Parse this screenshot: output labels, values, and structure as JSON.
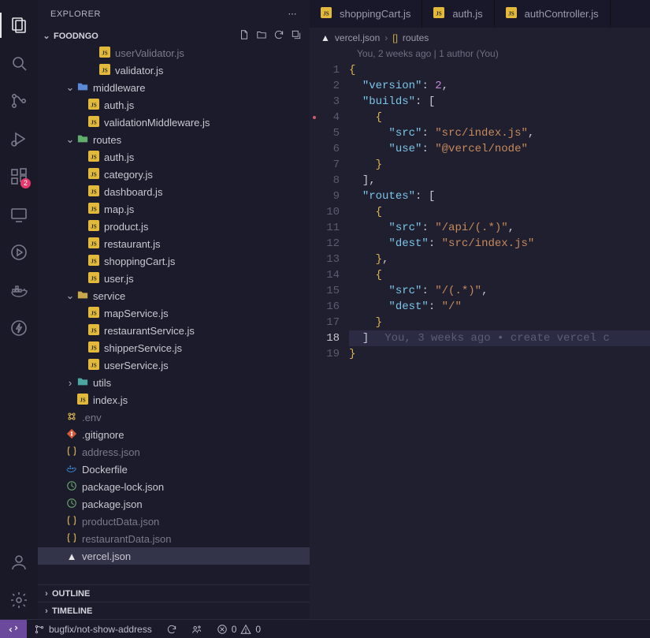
{
  "sidebar": {
    "title": "EXPLORER",
    "project": "FOODNGO",
    "panels": {
      "outline": "OUTLINE",
      "timeline": "TIMELINE"
    }
  },
  "tree": [
    {
      "indent": 4,
      "type": "file",
      "icon": "js",
      "name": "userValidator.js",
      "dim": true
    },
    {
      "indent": 4,
      "type": "file",
      "icon": "js",
      "name": "validator.js"
    },
    {
      "indent": 2,
      "type": "folder",
      "icon": "folder-blue",
      "name": "middleware",
      "open": true
    },
    {
      "indent": 3,
      "type": "file",
      "icon": "js",
      "name": "auth.js"
    },
    {
      "indent": 3,
      "type": "file",
      "icon": "js",
      "name": "validationMiddleware.js"
    },
    {
      "indent": 2,
      "type": "folder",
      "icon": "folder-green",
      "name": "routes",
      "open": true
    },
    {
      "indent": 3,
      "type": "file",
      "icon": "js",
      "name": "auth.js"
    },
    {
      "indent": 3,
      "type": "file",
      "icon": "js",
      "name": "category.js"
    },
    {
      "indent": 3,
      "type": "file",
      "icon": "js",
      "name": "dashboard.js"
    },
    {
      "indent": 3,
      "type": "file",
      "icon": "js",
      "name": "map.js"
    },
    {
      "indent": 3,
      "type": "file",
      "icon": "js",
      "name": "product.js"
    },
    {
      "indent": 3,
      "type": "file",
      "icon": "js",
      "name": "restaurant.js"
    },
    {
      "indent": 3,
      "type": "file",
      "icon": "js",
      "name": "shoppingCart.js"
    },
    {
      "indent": 3,
      "type": "file",
      "icon": "js",
      "name": "user.js"
    },
    {
      "indent": 2,
      "type": "folder",
      "icon": "folder-yellow",
      "name": "service",
      "open": true
    },
    {
      "indent": 3,
      "type": "file",
      "icon": "js",
      "name": "mapService.js"
    },
    {
      "indent": 3,
      "type": "file",
      "icon": "js",
      "name": "restaurantService.js"
    },
    {
      "indent": 3,
      "type": "file",
      "icon": "js",
      "name": "shipperService.js"
    },
    {
      "indent": 3,
      "type": "file",
      "icon": "js",
      "name": "userService.js"
    },
    {
      "indent": 2,
      "type": "folder",
      "icon": "folder-teal",
      "name": "utils",
      "open": false
    },
    {
      "indent": 2,
      "type": "file",
      "icon": "js",
      "name": "index.js"
    },
    {
      "indent": 1,
      "type": "file",
      "icon": "env",
      "name": ".env",
      "dim": true
    },
    {
      "indent": 1,
      "type": "file",
      "icon": "git",
      "name": ".gitignore"
    },
    {
      "indent": 1,
      "type": "file",
      "icon": "json",
      "name": "address.json",
      "dim": true
    },
    {
      "indent": 1,
      "type": "file",
      "icon": "docker",
      "name": "Dockerfile"
    },
    {
      "indent": 1,
      "type": "file",
      "icon": "pkg",
      "name": "package-lock.json"
    },
    {
      "indent": 1,
      "type": "file",
      "icon": "pkg",
      "name": "package.json"
    },
    {
      "indent": 1,
      "type": "file",
      "icon": "json",
      "name": "productData.json",
      "dim": true
    },
    {
      "indent": 1,
      "type": "file",
      "icon": "json",
      "name": "restaurantData.json",
      "dim": true
    },
    {
      "indent": 1,
      "type": "file",
      "icon": "vercel",
      "name": "vercel.json",
      "selected": true
    }
  ],
  "tabs": [
    {
      "icon": "js",
      "label": "shoppingCart.js"
    },
    {
      "icon": "js",
      "label": "auth.js"
    },
    {
      "icon": "js",
      "label": "authController.js"
    }
  ],
  "breadcrumb": {
    "file_icon": "vercel",
    "file": "vercel.json",
    "sep": "›",
    "symbol_icon": "[]",
    "symbol": "routes"
  },
  "git_annotation": "You, 2 weeks ago | 1 author (You)",
  "code": {
    "lines": [
      {
        "n": 1,
        "html": "<span class='tok-brace'>{</span>"
      },
      {
        "n": 2,
        "html": "  <span class='tok-key'>\"version\"</span><span class='tok-punc'>: </span><span class='tok-num'>2</span><span class='tok-punc'>,</span>"
      },
      {
        "n": 3,
        "html": "  <span class='tok-key'>\"builds\"</span><span class='tok-punc'>: [</span>"
      },
      {
        "n": 4,
        "mod": true,
        "html": "    <span class='tok-brace'>{</span>"
      },
      {
        "n": 5,
        "html": "      <span class='tok-key'>\"src\"</span><span class='tok-punc'>: </span><span class='tok-str'>\"src/index.js\"</span><span class='tok-punc'>,</span>"
      },
      {
        "n": 6,
        "html": "      <span class='tok-key'>\"use\"</span><span class='tok-punc'>: </span><span class='tok-str'>\"@vercel/node\"</span>"
      },
      {
        "n": 7,
        "html": "    <span class='tok-brace'>}</span>"
      },
      {
        "n": 8,
        "html": "  <span class='tok-punc'>],</span>"
      },
      {
        "n": 9,
        "html": "  <span class='tok-key'>\"routes\"</span><span class='tok-punc'>: [</span>"
      },
      {
        "n": 10,
        "html": "    <span class='tok-brace'>{</span>"
      },
      {
        "n": 11,
        "html": "      <span class='tok-key'>\"src\"</span><span class='tok-punc'>: </span><span class='tok-str'>\"/api/(.*)\"</span><span class='tok-punc'>,</span>"
      },
      {
        "n": 12,
        "html": "      <span class='tok-key'>\"dest\"</span><span class='tok-punc'>: </span><span class='tok-str'>\"src/index.js\"</span>"
      },
      {
        "n": 13,
        "html": "    <span class='tok-brace'>}</span><span class='tok-punc'>,</span>"
      },
      {
        "n": 14,
        "html": "    <span class='tok-brace'>{</span>"
      },
      {
        "n": 15,
        "html": "      <span class='tok-key'>\"src\"</span><span class='tok-punc'>: </span><span class='tok-str'>\"/(.*)\"</span><span class='tok-punc'>,</span>"
      },
      {
        "n": 16,
        "html": "      <span class='tok-key'>\"dest\"</span><span class='tok-punc'>: </span><span class='tok-str'>\"/\"</span>"
      },
      {
        "n": 17,
        "html": "    <span class='tok-brace'>}</span>"
      },
      {
        "n": 18,
        "hl": true,
        "html": "  <span class='tok-punc'>]</span><span class='blame'>You, 3 weeks ago • create vercel c</span>"
      },
      {
        "n": 19,
        "html": "<span class='tok-brace'>}</span>"
      }
    ]
  },
  "status": {
    "branch": "bugfix/not-show-address",
    "errors": "0",
    "warnings": "0"
  },
  "activity_badge": "2",
  "colors": {
    "bg": "#1e1e2e",
    "accent": "#6b4a9e",
    "badge": "#e5396c",
    "key": "#7cc5e8",
    "string": "#c78a5b",
    "number": "#c78ad6"
  }
}
